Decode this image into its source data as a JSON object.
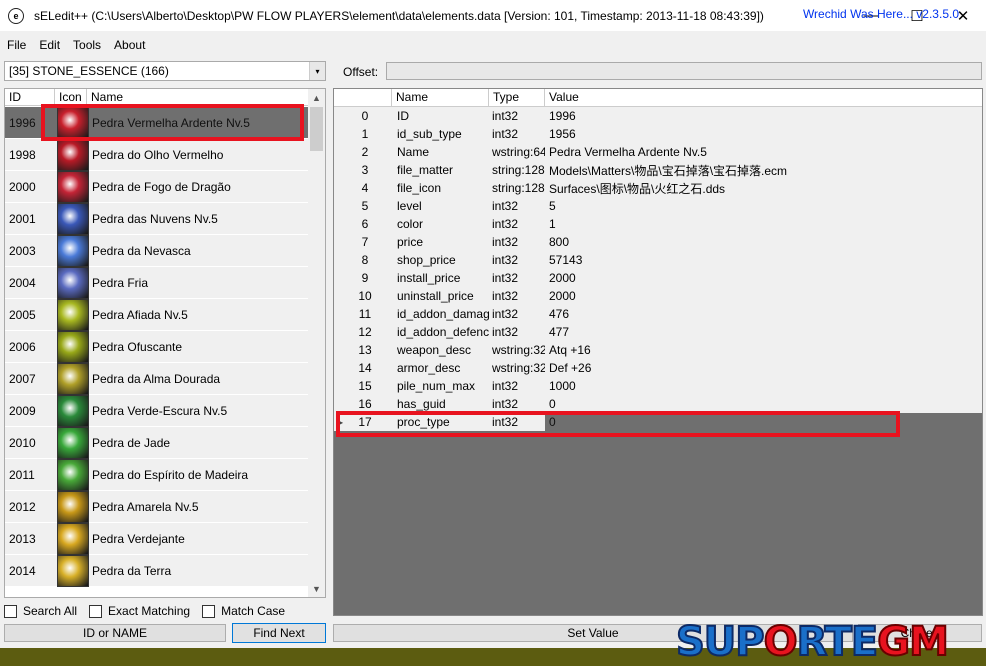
{
  "window": {
    "title": "sELedit++ (C:\\Users\\Alberto\\Desktop\\PW FLOW PLAYERS\\element\\data\\elements.data [Version: 101, Timestamp: 2013-11-18 08:43:39])",
    "minimize_glyph": "—",
    "maximize_glyph": "☐",
    "close_glyph": "✕"
  },
  "menu": {
    "file": "File",
    "edit": "Edit",
    "tools": "Tools",
    "about": "About"
  },
  "version_link": "Wrechid Was Here... v2.3.5.0",
  "list_selector": {
    "value": "[35] STONE_ESSENCE (166)",
    "arrow": "▾"
  },
  "item_list": {
    "headers": {
      "id": "ID",
      "icon": "Icon",
      "name": "Name"
    },
    "rows": [
      {
        "id": "1996",
        "name": "Pedra Vermelha Ardente Nv.5",
        "icon_color": "#c8202c",
        "selected": true
      },
      {
        "id": "1998",
        "name": "Pedra do Olho Vermelho",
        "icon_color": "#b81a26"
      },
      {
        "id": "2000",
        "name": "Pedra de Fogo de Dragão",
        "icon_color": "#c42436"
      },
      {
        "id": "2001",
        "name": "Pedra das Nuvens Nv.5",
        "icon_color": "#3a58b8"
      },
      {
        "id": "2003",
        "name": "Pedra da Nevasca",
        "icon_color": "#4a7ad8"
      },
      {
        "id": "2004",
        "name": "Pedra Fria",
        "icon_color": "#5a6ac0"
      },
      {
        "id": "2005",
        "name": "Pedra Afiada Nv.5",
        "icon_color": "#a8b820"
      },
      {
        "id": "2006",
        "name": "Pedra Ofuscante",
        "icon_color": "#98a818"
      },
      {
        "id": "2007",
        "name": "Pedra da Alma Dourada",
        "icon_color": "#b0a028"
      },
      {
        "id": "2009",
        "name": "Pedra Verde-Escura Nv.5",
        "icon_color": "#2a8a3a"
      },
      {
        "id": "2010",
        "name": "Pedra de Jade",
        "icon_color": "#38a83a"
      },
      {
        "id": "2011",
        "name": "Pedra do Espírito de Madeira",
        "icon_color": "#48a838"
      },
      {
        "id": "2012",
        "name": "Pedra Amarela Nv.5",
        "icon_color": "#c89818"
      },
      {
        "id": "2013",
        "name": "Pedra Verdejante",
        "icon_color": "#d8a820"
      },
      {
        "id": "2014",
        "name": "Pedra da Terra",
        "icon_color": "#d8b028"
      }
    ]
  },
  "search": {
    "search_all": "Search All",
    "exact_matching": "Exact Matching",
    "match_case": "Match Case",
    "field_placeholder": "ID or NAME",
    "find_next": "Find Next"
  },
  "offset_label": "Offset:",
  "fields": {
    "headers": {
      "name": "Name",
      "type": "Type",
      "value": "Value"
    },
    "rows": [
      {
        "idx": "0",
        "name": "ID",
        "type": "int32",
        "value": "1996"
      },
      {
        "idx": "1",
        "name": "id_sub_type",
        "type": "int32",
        "value": "1956"
      },
      {
        "idx": "2",
        "name": "Name",
        "type": "wstring:64",
        "value": "Pedra Vermelha Ardente Nv.5"
      },
      {
        "idx": "3",
        "name": "file_matter",
        "type": "string:128",
        "value": "Models\\Matters\\物品\\宝石掉落\\宝石掉落.ecm"
      },
      {
        "idx": "4",
        "name": "file_icon",
        "type": "string:128",
        "value": "Surfaces\\图标\\物品\\火红之石.dds"
      },
      {
        "idx": "5",
        "name": "level",
        "type": "int32",
        "value": "5"
      },
      {
        "idx": "6",
        "name": "color",
        "type": "int32",
        "value": "1"
      },
      {
        "idx": "7",
        "name": "price",
        "type": "int32",
        "value": "800"
      },
      {
        "idx": "8",
        "name": "shop_price",
        "type": "int32",
        "value": "57143"
      },
      {
        "idx": "9",
        "name": "install_price",
        "type": "int32",
        "value": "2000"
      },
      {
        "idx": "10",
        "name": "uninstall_price",
        "type": "int32",
        "value": "2000"
      },
      {
        "idx": "11",
        "name": "id_addon_damage",
        "type": "int32",
        "value": "476"
      },
      {
        "idx": "12",
        "name": "id_addon_defence",
        "type": "int32",
        "value": "477"
      },
      {
        "idx": "13",
        "name": "weapon_desc",
        "type": "wstring:32",
        "value": "Atq +16"
      },
      {
        "idx": "14",
        "name": "armor_desc",
        "type": "wstring:32",
        "value": "Def +26"
      },
      {
        "idx": "15",
        "name": "pile_num_max",
        "type": "int32",
        "value": "1000"
      },
      {
        "idx": "16",
        "name": "has_guid",
        "type": "int32",
        "value": "0"
      },
      {
        "idx": "17",
        "name": "proc_type",
        "type": "int32",
        "value": "0",
        "selected": true
      }
    ]
  },
  "set_value": "Set Value",
  "right_button": "Ch...ed",
  "watermark": {
    "part1": "SUP",
    "part2": "O",
    "part3": "RTE",
    "part4": "GM"
  },
  "colors": {
    "selection": "#6f6f6f",
    "highlight": "#e8131f",
    "link": "#0033ee"
  }
}
